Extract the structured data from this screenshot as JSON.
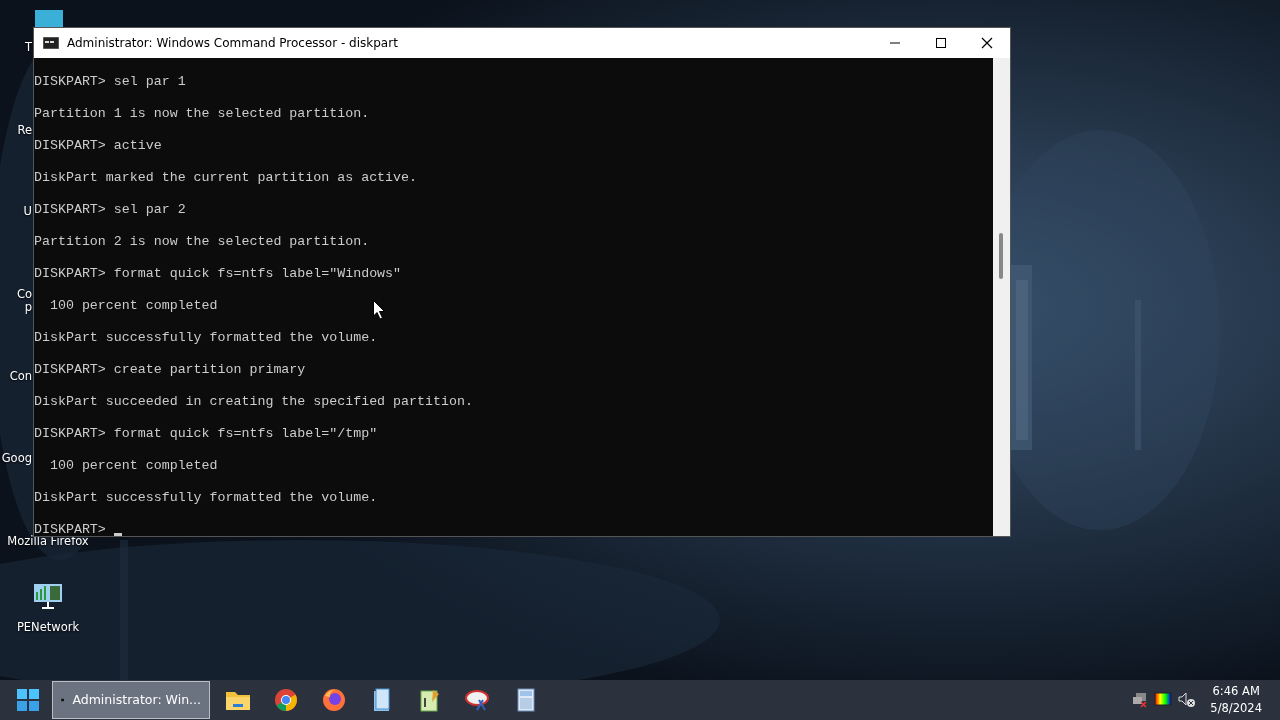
{
  "desktop_icons": [
    {
      "label_lines": [
        "T"
      ]
    },
    {
      "label_lines": [
        "Re"
      ]
    },
    {
      "label_lines": [
        "U"
      ]
    },
    {
      "label_lines": [
        "Co",
        "p"
      ]
    },
    {
      "label_lines": [
        "Con"
      ]
    },
    {
      "label_lines": [
        "Goog"
      ]
    },
    {
      "label_lines": [
        "Mozilla Firefox"
      ]
    },
    {
      "label_lines": [
        "PENetwork"
      ]
    }
  ],
  "window": {
    "title": "Administrator: Windows Command Processor - diskpart",
    "lines": [
      "DISKPART> sel par 1",
      "Partition 1 is now the selected partition.",
      "DISKPART> active",
      "DiskPart marked the current partition as active.",
      "DISKPART> sel par 2",
      "Partition 2 is now the selected partition.",
      "DISKPART> format quick fs=ntfs label=\"Windows\"",
      "  100 percent completed",
      "DiskPart successfully formatted the volume.",
      "DISKPART> create partition primary",
      "DiskPart succeeded in creating the specified partition.",
      "DISKPART> format quick fs=ntfs label=\"/tmp\"",
      "  100 percent completed",
      "DiskPart successfully formatted the volume.",
      "DISKPART> "
    ]
  },
  "taskbar": {
    "task": {
      "label": "Administrator: Win...",
      "selected": true
    },
    "time": "6:46 AM",
    "date": "5/8/2024"
  }
}
